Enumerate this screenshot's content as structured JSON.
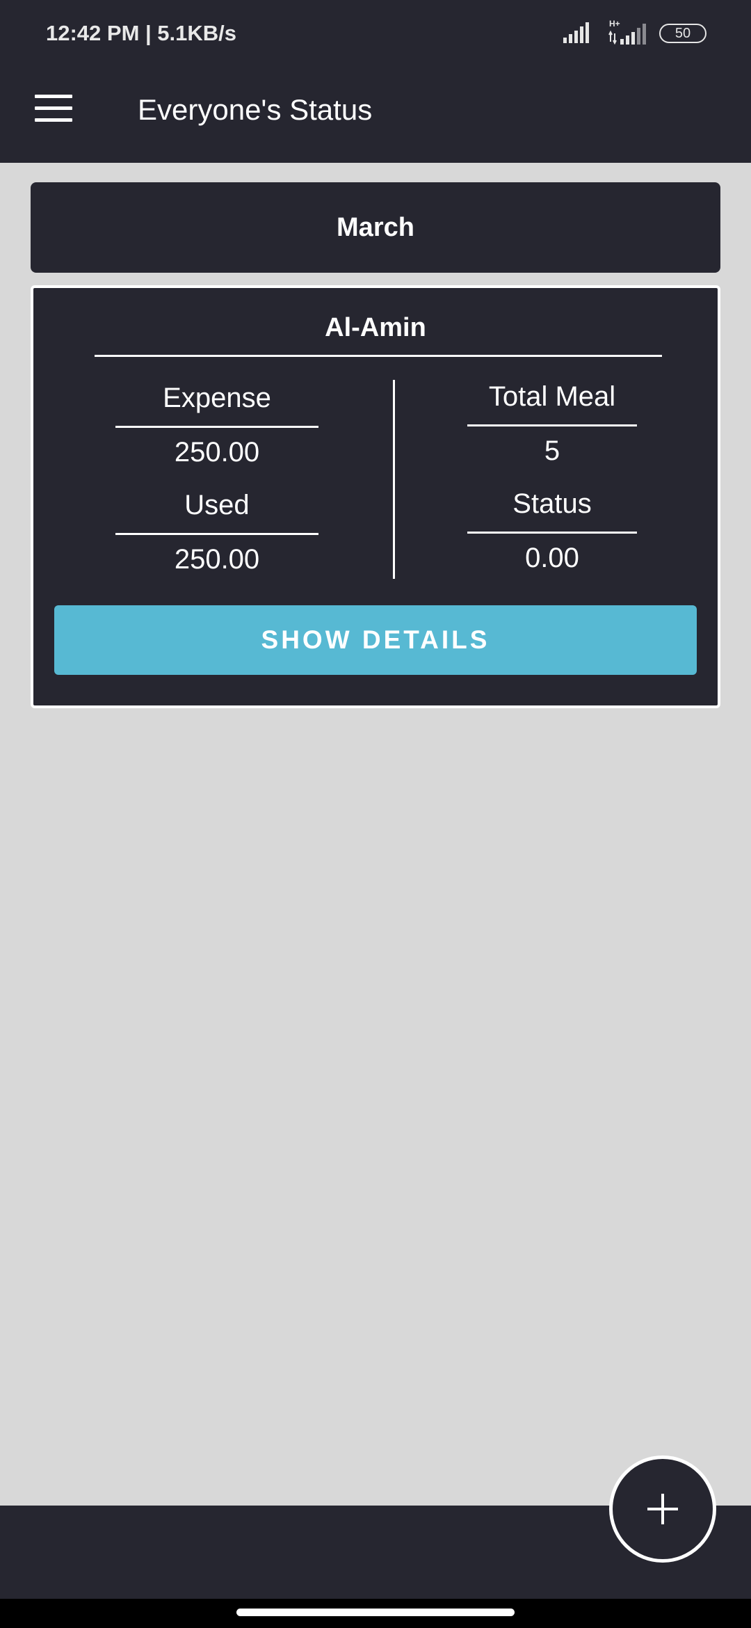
{
  "status_bar": {
    "time": "12:42 PM | 5.1KB/s",
    "network_type": "H+",
    "battery": "50",
    "icons": [
      "signal-icon",
      "signal-icon",
      "battery-icon"
    ]
  },
  "app_bar": {
    "title": "Everyone's Status",
    "menu_icon": "hamburger-menu-icon"
  },
  "month": "March",
  "member": {
    "name": "Al-Amin",
    "expense_label": "Expense",
    "expense_value": "250.00",
    "used_label": "Used",
    "used_value": "250.00",
    "total_meal_label": "Total Meal",
    "total_meal_value": "5",
    "status_label": "Status",
    "status_value": "0.00",
    "details_button": "SHOW DETAILS"
  },
  "fab": {
    "icon": "plus-icon"
  },
  "colors": {
    "dark": "#262630",
    "background": "#d8d8d8",
    "accent": "#57b9d3",
    "text": "#ffffff"
  }
}
